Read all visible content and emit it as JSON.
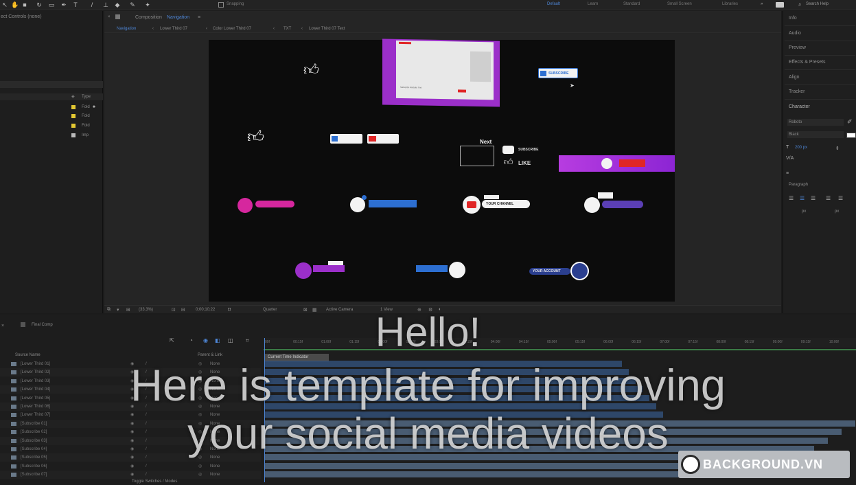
{
  "toolbar": {
    "snapping": "Snapping",
    "workspaces": [
      "Default",
      "Learn",
      "Standard",
      "Small Screen",
      "Libraries"
    ],
    "search_placeholder": "Search Help"
  },
  "left_panel": {
    "effect_controls": "ect Controls (none)",
    "type_header": "Type",
    "rows": [
      "Fold",
      "Fold",
      "Fold",
      "Imp"
    ]
  },
  "viewer": {
    "panel_title": "Composition",
    "comp_name": "Navigation",
    "breadcrumbs": [
      "Navigation",
      "Lower Third 07",
      "Color Lower Third 07",
      "TXT",
      "Lower Third 07 Text"
    ],
    "footer_zoom": "(33.3%)",
    "footer_time": "0;00;10;22",
    "footer_resolution": "Quarter",
    "footer_camera": "Active Camera",
    "footer_view": "1 View"
  },
  "canvas": {
    "next_label": "Next",
    "subscribe_label": "SUBSCRIBE",
    "like_label": "LIKE",
    "subscribe_btn": "SUBSCRIBE",
    "your_channel": "YOUR CHANNEL",
    "your_account": "YOUR ACCOUNT",
    "subscribe_text": "Subscribe Website Text"
  },
  "right_panel": {
    "items": [
      "Info",
      "Audio",
      "Preview",
      "Effects & Presets",
      "Align",
      "Tracker",
      "Character"
    ],
    "font": "Roboto",
    "style": "Black",
    "size": "200 px",
    "paragraph": "Paragraph",
    "px_label": "px"
  },
  "timeline": {
    "comp_tab": "Final Comp",
    "source_name": "Source Name",
    "parent_link": "Parent & Link",
    "current_time_indicator": "Current Time Indicator",
    "toggle": "Toggle Switches / Modes",
    "ruler": [
      "00f",
      "00:15f",
      "01:00f",
      "01:15f",
      "02:00f",
      "02:15f",
      "03:00f",
      "03:15f",
      "04:00f",
      "04:15f",
      "05:00f",
      "05:15f",
      "06:00f",
      "06:15f",
      "07:00f",
      "07:15f",
      "08:00f",
      "08:15f",
      "09:00f",
      "09:15f",
      "10:00f"
    ],
    "layers": [
      "[Lower Third 01]",
      "[Lower Third 02]",
      "[Lower Third 03]",
      "[Lower Third 04]",
      "[Lower Third 05]",
      "[Lower Third 06]",
      "[Lower Third 07]",
      "[Subscribe 01]",
      "[Subscribe 02]",
      "[Subscribe 03]",
      "[Subscribe 04]",
      "[Subscribe 05]",
      "[Subscribe 06]",
      "[Subscribe 07]"
    ],
    "parent_value": "None"
  },
  "caption": {
    "line1": "Hello!",
    "line2": "Here is template for improving",
    "line3": "your social media videos"
  },
  "logo": {
    "text": "BACKGROUND.VN"
  },
  "colors": {
    "accent_blue": "#2d6fd1",
    "purple": "#9b2fc9",
    "magenta": "#d6279e",
    "youtube_red": "#e02626"
  }
}
